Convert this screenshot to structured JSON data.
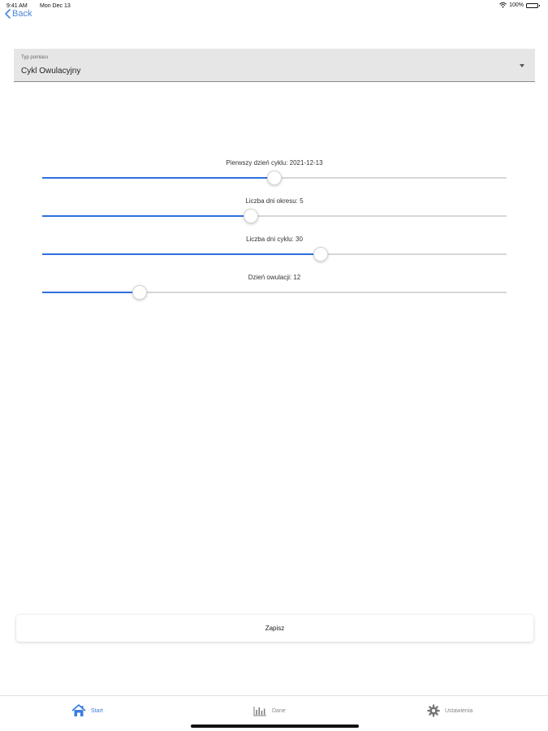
{
  "status_bar": {
    "time": "9:41 AM",
    "date": "Mon Dec 13",
    "battery": "100%",
    "battery_level": 1.0
  },
  "navigation": {
    "back_label": "Back"
  },
  "type_select": {
    "label": "Typ pomiaru",
    "value": "Cykl Owulacyjny"
  },
  "sliders": [
    {
      "label": "Pierwszy dzień cyklu: 2021-12-13",
      "fraction": 0.5
    },
    {
      "label": "Liczba dni okresu: 5",
      "fraction": 0.45
    },
    {
      "label": "Liczba dni cyklu: 30",
      "fraction": 0.6
    },
    {
      "label": "Dzień owulacji: 12",
      "fraction": 0.21
    }
  ],
  "actions": {
    "save_label": "Zapisz"
  },
  "tab_bar": {
    "items": [
      {
        "label": "Start",
        "icon": "home-icon",
        "active": true
      },
      {
        "label": "Dane",
        "icon": "bar-chart-icon",
        "active": false
      },
      {
        "label": "Ustawienia",
        "icon": "gear-icon",
        "active": false
      }
    ]
  },
  "colors": {
    "accent": "#2f6fdc",
    "active_tab": "#3b7de0",
    "select_background": "#e6e6e6"
  }
}
